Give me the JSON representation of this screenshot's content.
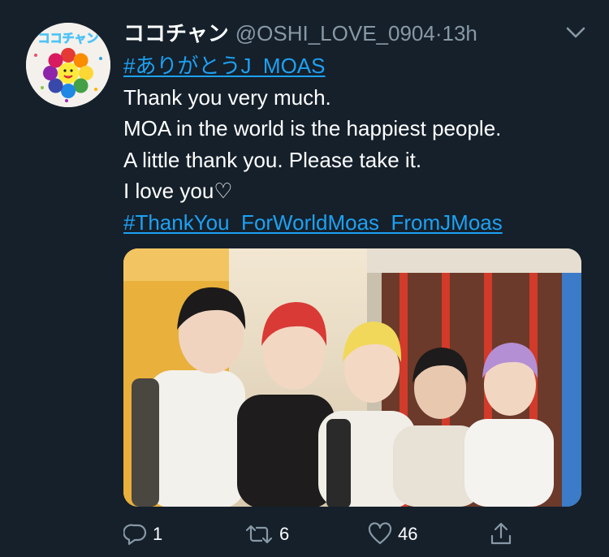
{
  "tweet": {
    "display_name": "ココチャン",
    "handle": "@OSHI_LOVE_0904",
    "separator": "·",
    "time": "13h",
    "avatar_text": "ココチャン",
    "lines": {
      "hashtag1": "#ありがとうJ_MOAS",
      "line1": "Thank you very much.",
      "line2": "MOA in the world is the happiest people.",
      "line3": "A little thank you.  Please take it.",
      "line4": "I love you♡",
      "hashtag2": "#ThankYou_ForWorldMoas_FromJMoas"
    }
  },
  "actions": {
    "reply_count": "1",
    "retweet_count": "6",
    "like_count": "46"
  },
  "colors": {
    "background": "#15202b",
    "link": "#1da1f2",
    "muted": "#8899a6",
    "text": "#ffffff"
  },
  "icons": [
    "chevron-down-icon",
    "reply-icon",
    "retweet-icon",
    "heart-icon",
    "share-icon"
  ]
}
